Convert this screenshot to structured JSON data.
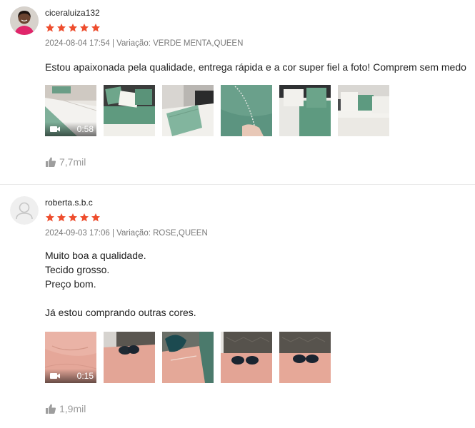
{
  "reviews": [
    {
      "username": "ciceraluiza132",
      "rating": 5,
      "meta": "2024-08-04 17:54 | Variação: VERDE MENTA,QUEEN",
      "text": "Estou apaixonada pela qualidade, entrega rápida e a cor super fiel a foto! Comprem sem medo",
      "video_duration": "0:58",
      "likes": "7,7mil",
      "photo_count": 5
    },
    {
      "username": "roberta.s.b.c",
      "rating": 5,
      "meta": "2024-09-03 17:06 | Variação: ROSE,QUEEN",
      "text": "Muito boa a qualidade.\nTecido grosso.\nPreço bom.\n\nJá estou comprando outras cores.",
      "video_duration": "0:15",
      "likes": "1,9mil",
      "photo_count": 4
    }
  ],
  "colors": {
    "star": "#ee4d2d",
    "meta": "#8a8a8a",
    "likes": "#9e9e9e"
  }
}
